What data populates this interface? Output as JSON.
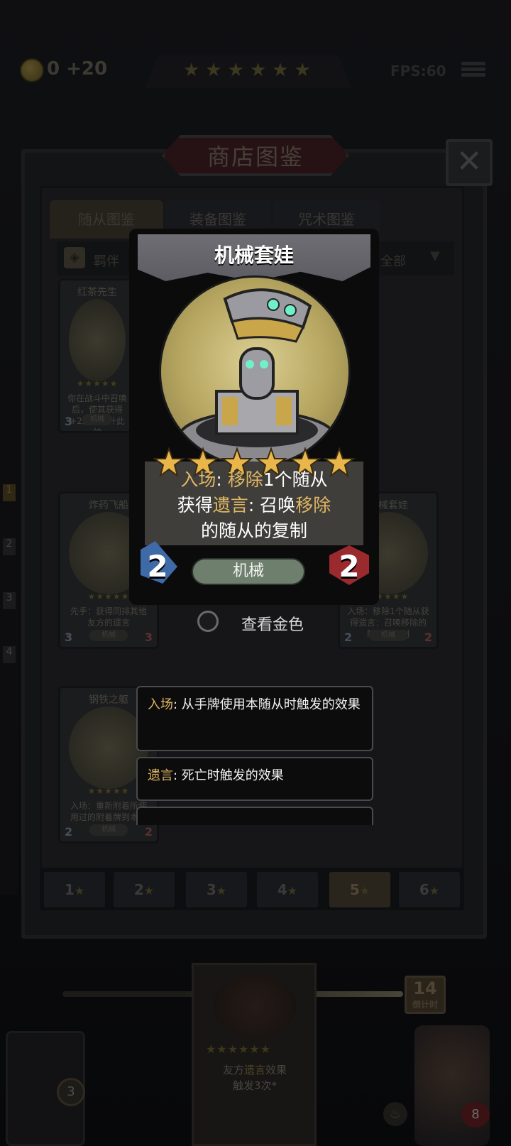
{
  "top": {
    "gold": "0 +20",
    "stars": "★★★★★★",
    "fps": "FPS:60"
  },
  "panel": {
    "title": "商店图鉴",
    "close": "✕",
    "tabs": [
      "随从图鉴",
      "装备图鉴",
      "咒术图鉴"
    ],
    "filter_left": "羁伴",
    "filter_right": "全部"
  },
  "bg_cards": [
    {
      "name": "红茶先生",
      "desc": "你在战斗中召唤后，使其获得+2永久提升此效",
      "tag": "机械",
      "atk": "3",
      "hp": ""
    },
    {
      "name": "炸药飞船",
      "desc": "先手：获得同排其他友方的遗言",
      "tag": "机械",
      "atk": "3",
      "hp": "3"
    },
    {
      "name": "机械套娃",
      "desc": "入场：移除1个随从获得遗言：召唤移除的随从的复制",
      "tag": "机械",
      "atk": "2",
      "hp": "2"
    },
    {
      "name": "钢铁之躯",
      "desc": "入场：重新附着所使用过的附着牌到本随从身上",
      "tag": "机械",
      "atk": "2",
      "hp": "2"
    }
  ],
  "card": {
    "name": "机械套娃",
    "stars": "★★★★★★",
    "line1_a": "入场",
    "line1_b": ": ",
    "line1_c": "移除",
    "line1_d": "1个随从",
    "line2_a": "获得",
    "line2_b": "遗言",
    "line2_c": ": 召唤",
    "line2_d": "移除",
    "line3": "的随从的复制",
    "tag": "机械",
    "attack": "2",
    "health": "2"
  },
  "view_gold": "查看金色",
  "tooltips": [
    {
      "key": "入场",
      "text": ": 从手牌使用本随从时触发的效果"
    },
    {
      "key": "遗言",
      "text": ": 死亡时触发的效果"
    }
  ],
  "pager": [
    {
      "num": "1",
      "active": false
    },
    {
      "num": "2",
      "active": false
    },
    {
      "num": "3",
      "active": false
    },
    {
      "num": "4",
      "active": false
    },
    {
      "num": "5",
      "active": true
    },
    {
      "num": "6",
      "active": false
    }
  ],
  "hud": {
    "timer_num": "14",
    "timer_label": "倒计时",
    "bottom_card_stars": "★★★★★★",
    "bottom_card_text_a": "友方",
    "bottom_card_text_b": "遗言",
    "bottom_card_text_c": "效果",
    "bottom_card_text_d": "触发3次*",
    "left_badge": "3",
    "hero_hp": "8"
  },
  "colors": {
    "keyword": "#e0b664",
    "star": "#e8b64a",
    "card_art": "#c8b979"
  }
}
